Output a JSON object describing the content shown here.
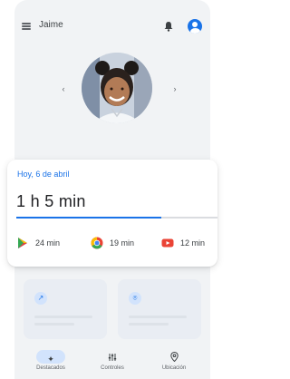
{
  "header": {
    "title": "Jaime"
  },
  "summary": {
    "date": "Hoy, 6 de abril",
    "total": "1 h 5 min",
    "progress": 0.72
  },
  "apps": [
    {
      "icon": "play-store-icon",
      "time": "24 min",
      "color": "#1a73e8"
    },
    {
      "icon": "chrome-icon",
      "time": "19 min",
      "color": "#fbbc04"
    },
    {
      "icon": "youtube-icon",
      "time": "12 min",
      "color": "#ea4335"
    }
  ],
  "tiles": [
    {
      "icon": "trending-icon"
    },
    {
      "icon": "location-icon"
    }
  ],
  "nav": {
    "tabs": [
      {
        "label": "Destacados",
        "icon": "sparkle-icon",
        "active": true
      },
      {
        "label": "Controles",
        "icon": "sliders-icon",
        "active": false
      },
      {
        "label": "Ubicación",
        "icon": "location-icon",
        "active": false
      }
    ]
  },
  "colors": {
    "accent": "#1a73e8",
    "background": "#f1f3f5"
  }
}
